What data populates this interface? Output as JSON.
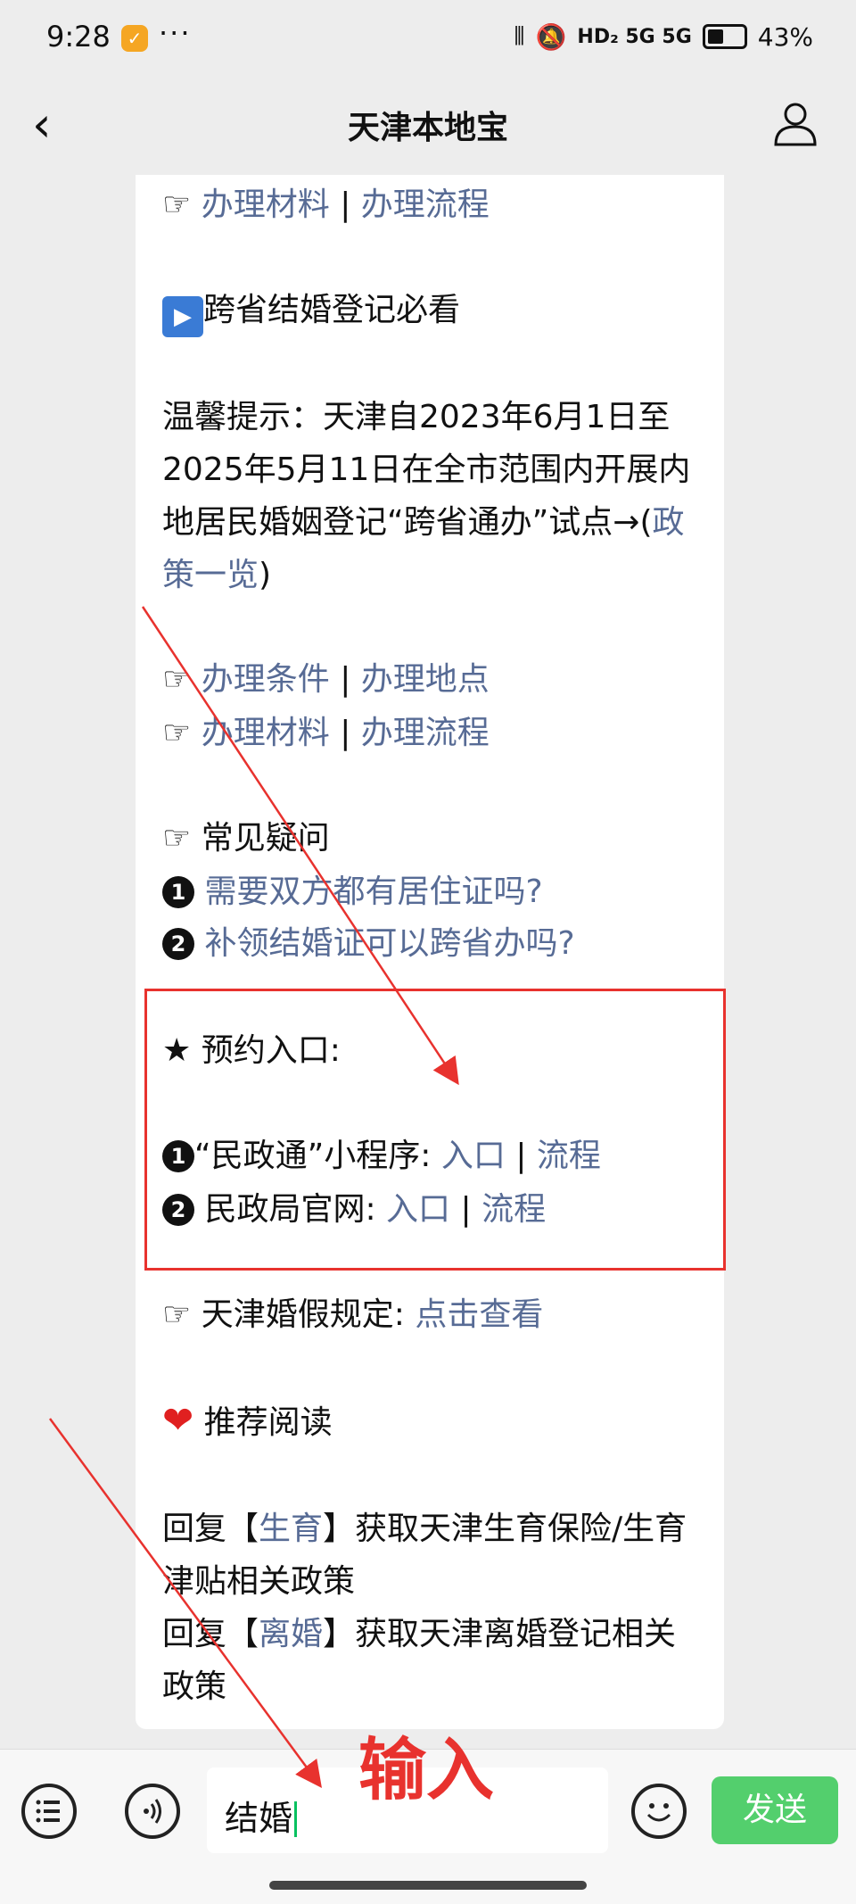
{
  "status_bar": {
    "time": "9:28",
    "dots": "···",
    "network": "HD₂ 5G 5G",
    "battery": "43%"
  },
  "nav": {
    "title": "天津本地宝"
  },
  "article": {
    "top_links": {
      "pointer": "☞",
      "a": "办理材料",
      "sep": " | ",
      "b": "办理流程"
    },
    "cross_province": {
      "icon": "▶",
      "text": "跨省结婚登记必看"
    },
    "tip_prefix": "温馨提示：天津自2023年6月1日至2025年5月11日在全市范围内开展内地居民婚姻登记“跨省通办”试点→(",
    "tip_link": "政策一览",
    "tip_suffix": ")",
    "conditions": {
      "pointer": "☞",
      "a": "办理条件",
      "sep": " | ",
      "b": "办理地点"
    },
    "materials": {
      "pointer": "☞",
      "a": "办理材料",
      "sep": " | ",
      "b": "办理流程"
    },
    "faq": {
      "pointer": "☞",
      "title": "常见疑问",
      "q1_num": "1",
      "q1": "需要双方都有居住证吗?",
      "q2_num": "2",
      "q2": "补领结婚证可以跨省办吗?"
    },
    "booking": {
      "star": "★",
      "title": "预约入口:",
      "item1_num": "1",
      "item1_label": "“民政通”小程序:",
      "item1_entry": "入口",
      "item1_sep": " | ",
      "item1_flow": "流程",
      "item2_num": "2",
      "item2_label": "民政局官网:",
      "item2_entry": "入口",
      "item2_sep": " | ",
      "item2_flow": "流程"
    },
    "leave": {
      "pointer": "☞",
      "label": "天津婚假规定:",
      "link": "点击查看"
    },
    "recommend": {
      "heart": "❤",
      "title": "推荐阅读"
    },
    "reply1": {
      "pre": "回复【",
      "kw": "生育",
      "post": "】获取天津生育保险/生育津贴相关政策"
    },
    "reply2": {
      "pre": "回复【",
      "kw": "离婚",
      "post": "】获取天津离婚登记相关政策"
    }
  },
  "bottom": {
    "input_value": "结婚",
    "send_label": "发送"
  },
  "annotation": {
    "text": "输入",
    "color": "#e8322e"
  },
  "colors": {
    "link": "#576b95",
    "send": "#53cf6d"
  }
}
